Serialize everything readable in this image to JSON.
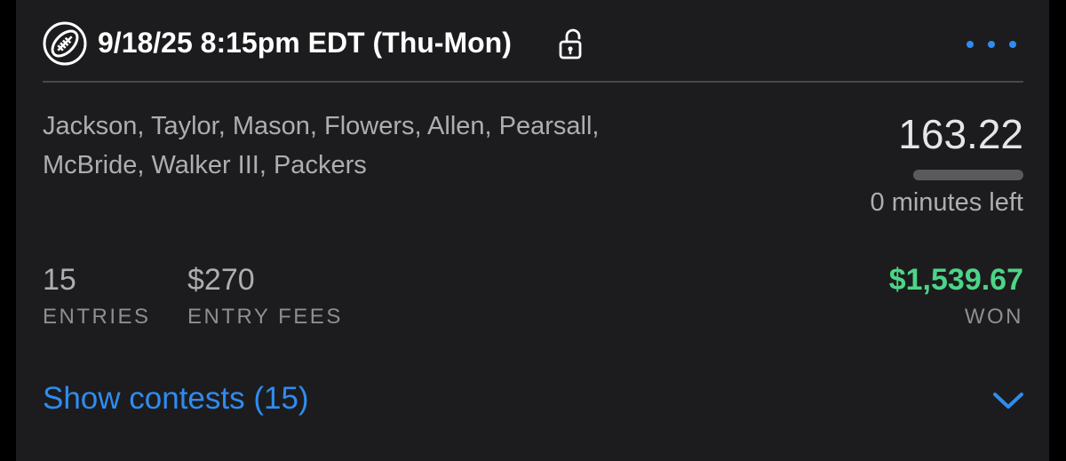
{
  "header": {
    "icon": "football-icon",
    "title": "9/18/25 8:15pm EDT (Thu-Mon)",
    "lock_icon": "unlock-icon",
    "more_icon": "ellipsis-icon"
  },
  "lineup": {
    "players_line1": "Jackson, Taylor, Mason, Flowers, Allen, Pearsall,",
    "players_line2": "McBride, Walker III, Packers"
  },
  "score": {
    "points": "163.22",
    "progress": 1.0,
    "time_left": "0 minutes left"
  },
  "stats": {
    "entries_value": "15",
    "entries_label": "ENTRIES",
    "fees_value": "$270",
    "fees_label": "ENTRY FEES",
    "won_value": "$1,539.67",
    "won_label": "WON"
  },
  "footer": {
    "show_contests_label": "Show contests (15)",
    "chevron_icon": "chevron-down-icon"
  },
  "colors": {
    "card_background": "#1c1c1e",
    "accent_blue": "#2f8cf0",
    "won_green": "#4cd586",
    "muted_text": "#aeaeb2"
  }
}
